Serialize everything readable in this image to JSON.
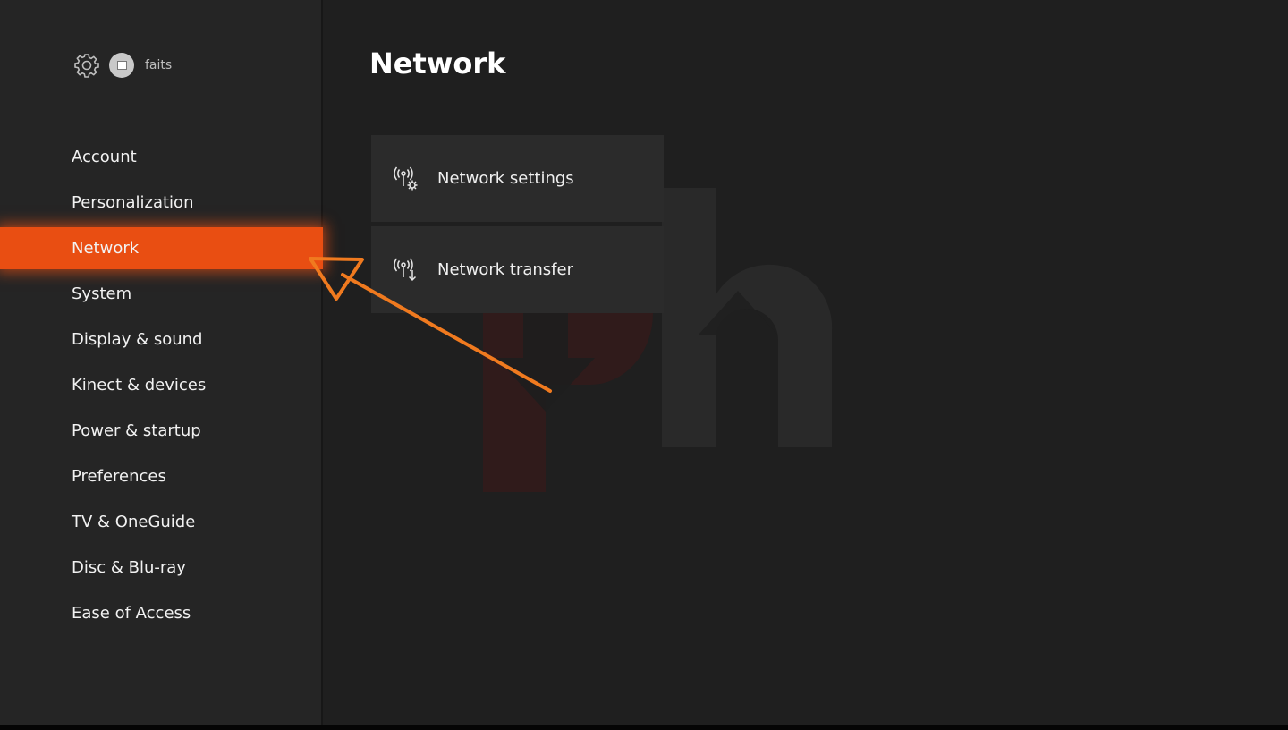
{
  "profile": {
    "gamertag": "faits",
    "icon": "gear-icon"
  },
  "sidebar": {
    "items": [
      {
        "label": "Account"
      },
      {
        "label": "Personalization"
      },
      {
        "label": "Network",
        "selected": true
      },
      {
        "label": "System"
      },
      {
        "label": "Display & sound"
      },
      {
        "label": "Kinect & devices"
      },
      {
        "label": "Power & startup"
      },
      {
        "label": "Preferences"
      },
      {
        "label": "TV & OneGuide"
      },
      {
        "label": "Disc & Blu-ray"
      },
      {
        "label": "Ease of Access"
      }
    ]
  },
  "main": {
    "title": "Network",
    "tiles": [
      {
        "label": "Network settings",
        "icon": "network-settings-icon"
      },
      {
        "label": "Network transfer",
        "icon": "network-transfer-icon"
      }
    ]
  },
  "colors": {
    "accent": "#e94e12",
    "sidebar_bg": "#252525",
    "main_bg": "#1f1f1f",
    "tile_bg": "#2b2b2b",
    "annotation": "#f07a1f"
  }
}
